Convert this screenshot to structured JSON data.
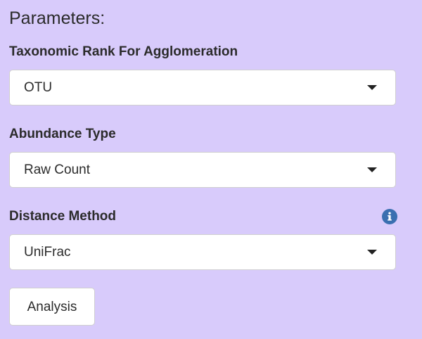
{
  "panel": {
    "heading": "Parameters:",
    "background_color": "#d8cbfb"
  },
  "fields": [
    {
      "label": "Taxonomic Rank For Agglomeration",
      "selected": "OTU"
    },
    {
      "label": "Abundance Type",
      "selected": "Raw Count"
    },
    {
      "label": "Distance Method",
      "selected": "UniFrac",
      "has_info_icon": true,
      "info_icon": "info-circle-icon",
      "info_icon_color": "#3a6fb0"
    }
  ],
  "actions": {
    "analysis_label": "Analysis"
  }
}
